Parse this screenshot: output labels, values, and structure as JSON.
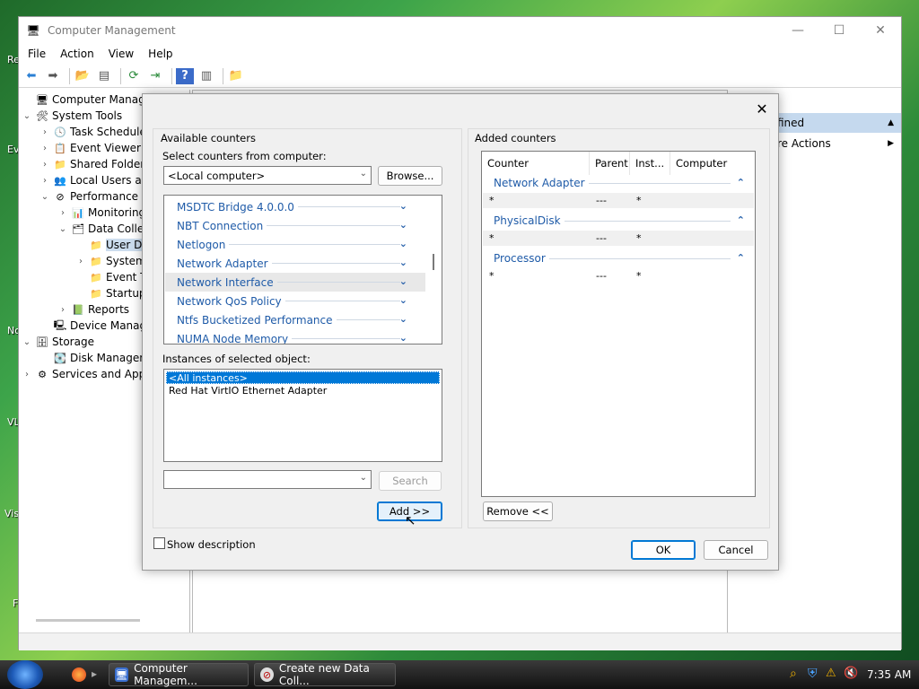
{
  "desktop": {
    "icon_labels": [
      "Re",
      "Ev",
      "No",
      "VL",
      "Vis",
      "F"
    ]
  },
  "window": {
    "title": "Computer Management",
    "menu": [
      "File",
      "Action",
      "View",
      "Help"
    ]
  },
  "tree": {
    "items": [
      {
        "label": "Computer Managem",
        "icon": "computer-icon"
      },
      {
        "label": "System Tools",
        "icon": "tools-icon"
      },
      {
        "label": "Task Schedule",
        "icon": "clock-icon"
      },
      {
        "label": "Event Viewer",
        "icon": "event-viewer-icon"
      },
      {
        "label": "Shared Folders",
        "icon": "shared-folder-icon"
      },
      {
        "label": "Local Users an",
        "icon": "users-icon"
      },
      {
        "label": "Performance",
        "icon": "performance-icon"
      },
      {
        "label": "Monitoring",
        "icon": "monitor-icon"
      },
      {
        "label": "Data Colle",
        "icon": "data-collector-icon"
      },
      {
        "label": "User De",
        "icon": "user-folder-icon"
      },
      {
        "label": "System",
        "icon": "folder-icon"
      },
      {
        "label": "Event T",
        "icon": "folder-icon"
      },
      {
        "label": "Startup",
        "icon": "folder-icon"
      },
      {
        "label": "Reports",
        "icon": "reports-icon"
      },
      {
        "label": "Device Manag",
        "icon": "device-manager-icon"
      },
      {
        "label": "Storage",
        "icon": "storage-icon"
      },
      {
        "label": "Disk Managem",
        "icon": "disk-icon"
      },
      {
        "label": "Services and Appl",
        "icon": "services-icon"
      }
    ]
  },
  "actions": {
    "header": "fined",
    "item": "re Actions"
  },
  "dialog": {
    "available_title": "Available counters",
    "select_label": "Select counters from computer:",
    "computer_value": "<Local computer>",
    "browse": "Browse...",
    "counters": [
      "MSDTC Bridge 4.0.0.0",
      "NBT Connection",
      "Netlogon",
      "Network Adapter",
      "Network Interface",
      "Network QoS Policy",
      "Ntfs Bucketized Performance",
      "NUMA Node Memory"
    ],
    "selected_counter": "Network Interface",
    "instances_label": "Instances of selected object:",
    "instances": [
      "<All instances>",
      "Red Hat VirtIO Ethernet Adapter"
    ],
    "search_value": "",
    "search_button": "Search",
    "add_button": "Add >>",
    "show_description": "Show description",
    "added_title": "Added counters",
    "columns": [
      "Counter",
      "Parent",
      "Inst...",
      "Computer"
    ],
    "added_groups": [
      {
        "name": "Network Adapter",
        "counter": "*",
        "parent": "---",
        "instance": "*"
      },
      {
        "name": "PhysicalDisk",
        "counter": "*",
        "parent": "---",
        "instance": "*"
      },
      {
        "name": "Processor",
        "counter": "*",
        "parent": "---",
        "instance": "*"
      }
    ],
    "remove_button": "Remove <<",
    "ok_button": "OK",
    "cancel_button": "Cancel"
  },
  "taskbar": {
    "tasks": [
      "Computer Managem...",
      "Create new Data Coll..."
    ],
    "clock": "7:35 AM"
  }
}
